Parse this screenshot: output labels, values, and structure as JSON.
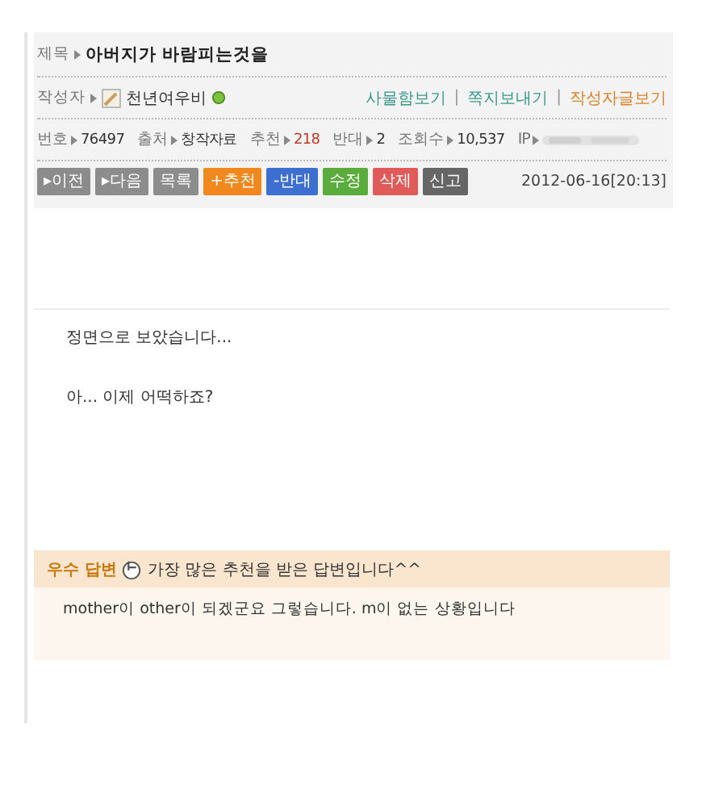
{
  "post": {
    "title_label": "제목",
    "title": "아버지가 바람피는것을",
    "author_label": "작성자",
    "author": "천년여우비",
    "author_online": true,
    "author_links": [
      {
        "label": "사물함보기",
        "color": "#3a9a8a"
      },
      {
        "separator": "|",
        "label": "쪽지보내기",
        "color": "#3a9a8a"
      },
      {
        "separator": "|",
        "label": "작성자글보기",
        "color": "#d9822b"
      }
    ],
    "meta": [
      {
        "label": "번호",
        "value": "76497",
        "highlight": false
      },
      {
        "label": "출처",
        "value": "창작자료",
        "highlight": false
      },
      {
        "label": "추천",
        "value": "218",
        "highlight": true
      },
      {
        "label": "반대",
        "value": "2",
        "highlight": false
      },
      {
        "label": "조회수",
        "value": "10,537",
        "highlight": false
      }
    ],
    "ip_label": "IP",
    "buttons": [
      {
        "label": "▸이전",
        "color": "#8c8c8c"
      },
      {
        "label": "▸다음",
        "color": "#8c8c8c"
      },
      {
        "label": "목록",
        "color": "#8c8c8c"
      },
      {
        "label": "+추천",
        "color": "#f0881e"
      },
      {
        "label": "-반대",
        "color": "#3d6fd0"
      },
      {
        "label": "수정",
        "color": "#5aac3c"
      },
      {
        "label": "삭제",
        "color": "#e05a5a"
      },
      {
        "label": "신고",
        "color": "#666666"
      }
    ],
    "date": "2012-06-16[20:13]",
    "body": [
      "정면으로 보았습니다...",
      "아... 이제 어떡하죠?"
    ]
  },
  "best_answer": {
    "badge": "우수 답변",
    "caption": "가장 많은 추천을 받은 답변입니다^^",
    "text": "mother이 other이 되겠군요 그렇습니다. m이 없는 상황입니다"
  }
}
